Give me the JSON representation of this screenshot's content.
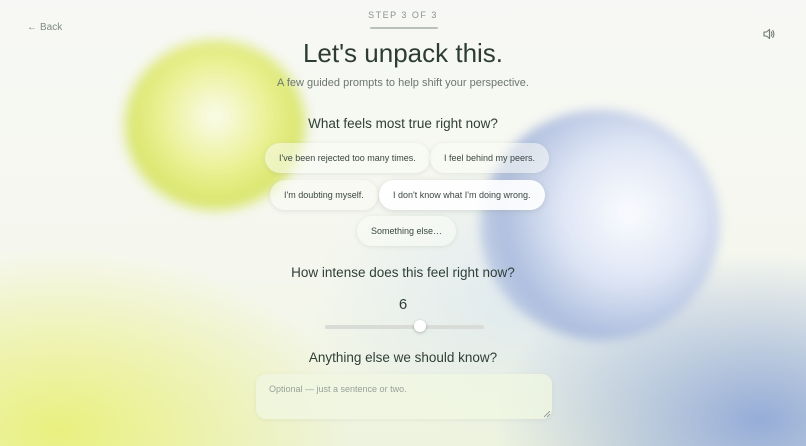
{
  "nav": {
    "back_label": "Back",
    "back_arrow": "←",
    "sound_icon": "speaker-icon"
  },
  "progress": {
    "step_label": "STEP 3 OF 3",
    "current": 3,
    "total": 3
  },
  "header": {
    "title": "Let's unpack this.",
    "subtitle": "A few guided prompts to help shift your perspective."
  },
  "feelings": {
    "question": "What feels most true right now?",
    "options": [
      {
        "label": "I've been rejected too many times.",
        "selected": false
      },
      {
        "label": "I feel behind my peers.",
        "selected": false
      },
      {
        "label": "I'm doubting myself.",
        "selected": false
      },
      {
        "label": "I don't know what I'm doing wrong.",
        "selected": true
      },
      {
        "label": "Something else…",
        "selected": false
      }
    ]
  },
  "intensity": {
    "question": "How intense does this feel right now?",
    "value": 6,
    "value_label": "6",
    "min": 0,
    "max": 10
  },
  "notes": {
    "question": "Anything else we should know?",
    "placeholder": "Optional — just a sentence or two.",
    "value": ""
  },
  "colors": {
    "accent_yellow": "#d9e65a",
    "accent_blue": "#a5b6dc",
    "text_dark": "#2f3f37",
    "text_muted": "#6c7670"
  }
}
